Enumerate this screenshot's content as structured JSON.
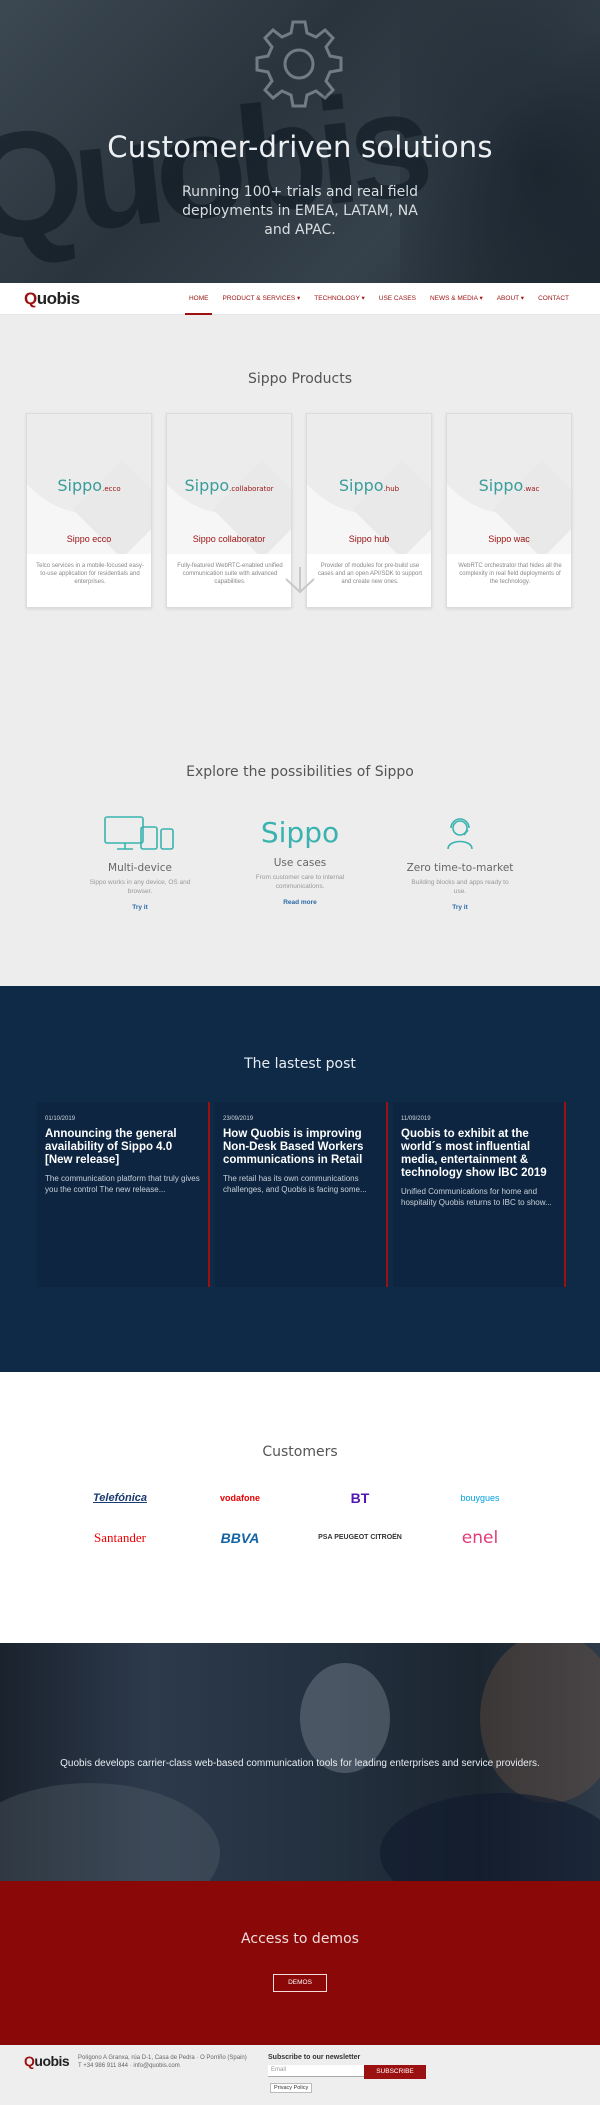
{
  "hero": {
    "title": "Customer-driven solutions",
    "subtitle": "Running 100+ trials and real field deployments in EMEA, LATAM, NA and APAC.",
    "bg_text": "Quobis"
  },
  "nav": {
    "logo_prefix": "Q",
    "logo_rest": "uobis",
    "items": [
      {
        "label": "HOME"
      },
      {
        "label": "PRODUCT & SERVICES ▾"
      },
      {
        "label": "TECHNOLOGY ▾"
      },
      {
        "label": "USE CASES"
      },
      {
        "label": "NEWS & MEDIA ▾"
      },
      {
        "label": "ABOUT ▾"
      },
      {
        "label": "CONTACT"
      }
    ]
  },
  "products": {
    "title": "Sippo Products",
    "cards": [
      {
        "brand": "Sippo",
        "suffix": ".ecco",
        "name": "Sippo ecco",
        "desc": "Telco services in a mobile-focused easy-to-use application for residentials and enterprises."
      },
      {
        "brand": "Sippo",
        "suffix": ".collaborator",
        "name": "Sippo collaborator",
        "desc": "Fully-featured WebRTC-enabled unified communication suite with advanced capabilities."
      },
      {
        "brand": "Sippo",
        "suffix": ".hub",
        "name": "Sippo hub",
        "desc": "Provider of modules for pre-build use cases and an open API/SDK to support and create new ones."
      },
      {
        "brand": "Sippo",
        "suffix": ".wac",
        "name": "Sippo wac",
        "desc": "WebRTC orchestrator that hides all the complexity in real field deployments of the technology."
      }
    ]
  },
  "explore": {
    "title": "Explore the possibilities of Sippo",
    "features": [
      {
        "icon": "devices-icon",
        "title": "Multi-device",
        "desc": "Sippo works in any device, OS and browser.",
        "link": "Try it"
      },
      {
        "icon": "sippo-logo-icon",
        "logo_text": "Sippo",
        "title": "Use cases",
        "desc": "From customer care to internal communications.",
        "link": "Read more"
      },
      {
        "icon": "agent-headset-icon",
        "title": "Zero time-to-market",
        "desc": "Building blocks and apps ready to use.",
        "link": "Try it"
      }
    ]
  },
  "posts": {
    "title": "The lastest post",
    "items": [
      {
        "date": "01/10/2019",
        "title": "Announcing the general availability of Sippo 4.0 [New release]",
        "excerpt": "The communication platform that truly gives you the control The new release..."
      },
      {
        "date": "23/09/2019",
        "title": "How Quobis is improving Non-Desk Based Workers communications in Retail",
        "excerpt": "The retail has its own communications challenges, and Quobis is facing some..."
      },
      {
        "date": "11/09/2019",
        "title": "Quobis to exhibit at the world´s most influential media, entertainment & technology show IBC 2019",
        "excerpt": "Unified Communications for home and hospitality Quobis returns to IBC to show..."
      }
    ]
  },
  "customers": {
    "title": "Customers",
    "logos": [
      "Telefónica",
      "vodafone",
      "BT",
      "bouygues",
      "Santander",
      "BBVA",
      "PSA PEUGEOT CITROËN",
      "enel"
    ]
  },
  "photo": {
    "caption": "Quobis develops carrier-class web-based communication tools for leading enterprises and service providers."
  },
  "demos": {
    "title": "Access to demos",
    "button": "DEMOS"
  },
  "footer": {
    "logo_prefix": "Q",
    "logo_rest": "uobis",
    "address": "Polígono A Granxa, rúa D-1, Casa de Pedra · O Porriño (Spain)",
    "contact": "T +34 986 911 844 · info@quobis.com",
    "newsletter_title": "Subscribe to our newsletter",
    "email_placeholder": "Email",
    "subscribe": "SUBSCRIBE",
    "privacy": "Privacy Policy"
  },
  "colors": {
    "accent": "#9b1111",
    "navy": "#0f2a46",
    "teal": "#3a9d9b"
  }
}
